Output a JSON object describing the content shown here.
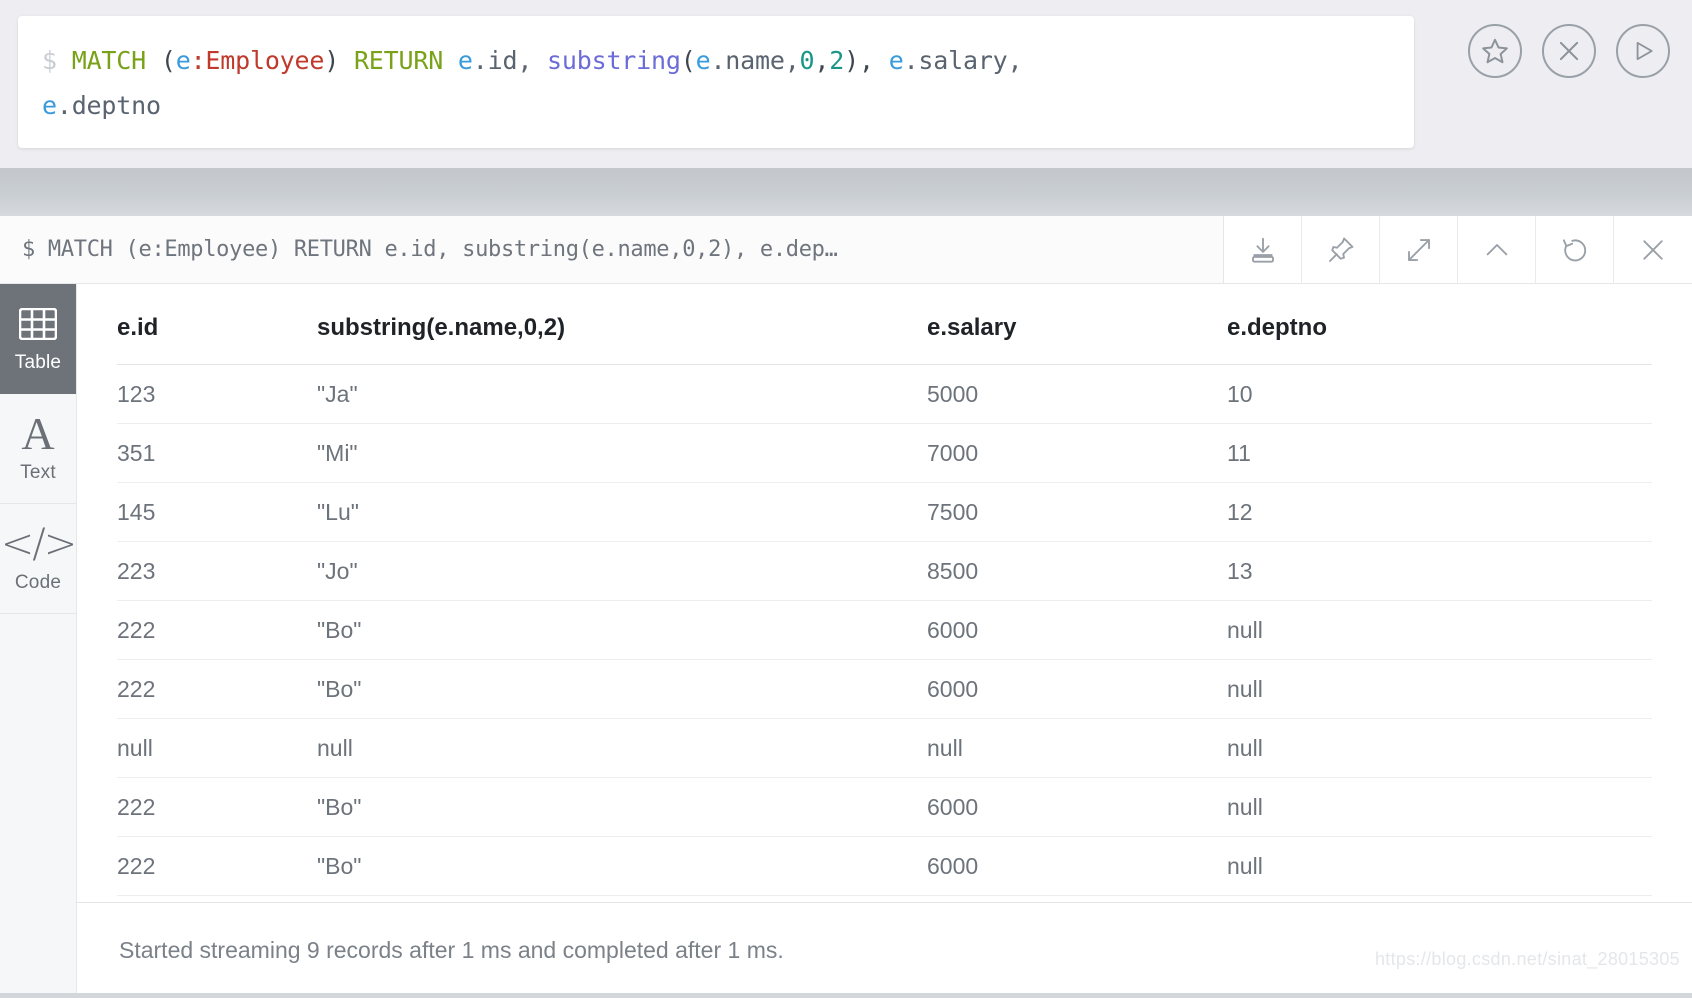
{
  "editor": {
    "prompt": "$",
    "query_full": "MATCH (e:Employee) RETURN e.id, substring(e.name,0,2), e.salary, e.deptno",
    "tokens_line1": {
      "prompt": "$",
      "keyword_match": "MATCH",
      "paren_open": "(",
      "var_e": "e",
      "label_employee": ":Employee",
      "paren_close": ")",
      "keyword_return": "RETURN",
      "var_e2": "e",
      "prop_id": ".id,",
      "func_substring": "substring",
      "func_paren_open": "(",
      "var_e3": "e",
      "prop_name": ".name,",
      "num_0": "0",
      "comma_1": ",",
      "num_2": "2",
      "func_paren_close": ")",
      "comma_2": ",",
      "var_e4": "e",
      "prop_salary": ".salary,"
    },
    "tokens_line2": {
      "var_e": "e",
      "prop_deptno": ".deptno"
    },
    "actions": [
      {
        "name": "favorite-button",
        "icon": "star-icon",
        "label": "Favorite"
      },
      {
        "name": "clear-button",
        "icon": "close-circle-icon",
        "label": "Clear"
      },
      {
        "name": "run-button",
        "icon": "play-icon",
        "label": "Run"
      }
    ]
  },
  "frame": {
    "title": "$ MATCH (e:Employee) RETURN e.id, substring(e.name,0,2), e.dep…",
    "tools": [
      {
        "name": "download-button",
        "icon": "download-icon",
        "label": "Download"
      },
      {
        "name": "pin-button",
        "icon": "pin-icon",
        "label": "Pin"
      },
      {
        "name": "fullscreen-button",
        "icon": "expand-icon",
        "label": "Fullscreen"
      },
      {
        "name": "collapse-button",
        "icon": "chevron-up-icon",
        "label": "Collapse"
      },
      {
        "name": "rerun-button",
        "icon": "refresh-icon",
        "label": "Rerun"
      },
      {
        "name": "close-button",
        "icon": "close-icon",
        "label": "Close"
      }
    ]
  },
  "view_tabs": [
    {
      "name": "tab-table",
      "label": "Table",
      "icon": "table-grid-icon",
      "active": true
    },
    {
      "name": "tab-text",
      "label": "Text",
      "icon": "letter-a-icon",
      "active": false
    },
    {
      "name": "tab-code",
      "label": "Code",
      "icon": "code-brackets-icon",
      "active": false
    }
  ],
  "table": {
    "columns": [
      "e.id",
      "substring(e.name,0,2)",
      "e.salary",
      "e.deptno"
    ],
    "rows": [
      [
        "123",
        "\"Ja\"",
        "5000",
        "10"
      ],
      [
        "351",
        "\"Mi\"",
        "7000",
        "11"
      ],
      [
        "145",
        "\"Lu\"",
        "7500",
        "12"
      ],
      [
        "223",
        "\"Jo\"",
        "8500",
        "13"
      ],
      [
        "222",
        "\"Bo\"",
        "6000",
        "null"
      ],
      [
        "222",
        "\"Bo\"",
        "6000",
        "null"
      ],
      [
        "null",
        "null",
        "null",
        "null"
      ],
      [
        "222",
        "\"Bo\"",
        "6000",
        "null"
      ],
      [
        "222",
        "\"Bo\"",
        "6000",
        "null"
      ]
    ]
  },
  "status": {
    "message": "Started streaming 9 records after 1 ms and completed after 1 ms."
  },
  "watermark": {
    "text": "https://blog.csdn.net/sinat_28015305"
  },
  "colors": {
    "keyword": "#79a218",
    "variable": "#3a9bdc",
    "label": "#c0392b",
    "function": "#6c6cd8",
    "number": "#1a9688",
    "property": "#5a6470",
    "active_tab_bg": "#6e7279"
  }
}
